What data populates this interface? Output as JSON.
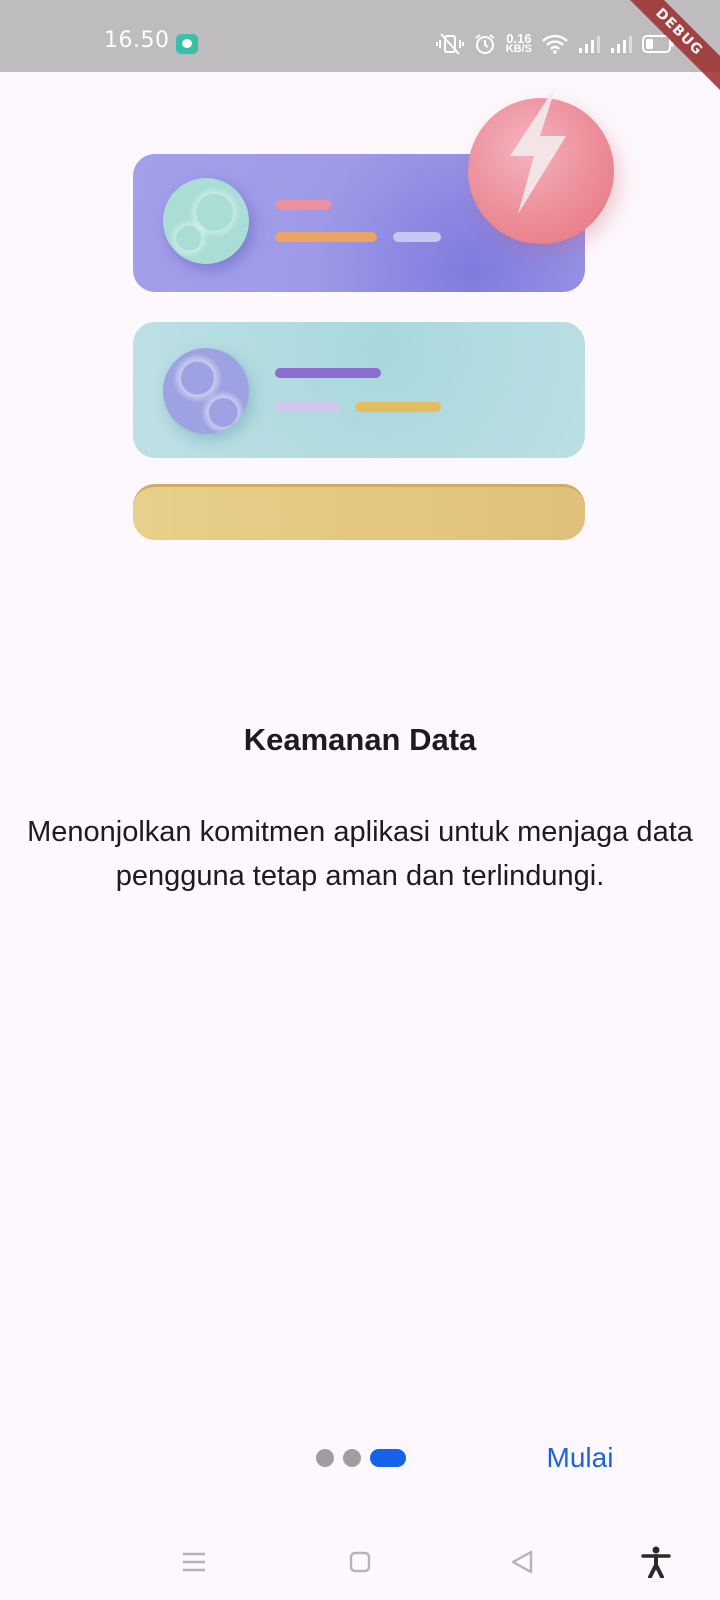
{
  "status_bar": {
    "time": "16.50",
    "net_speed_value": "0.16",
    "net_speed_unit": "KB/S"
  },
  "debug_banner": "DEBUG",
  "onboarding": {
    "title": "Keamanan Data",
    "description": "Menonjolkan komitmen aplikasi untuk menjaga data pengguna tetap aman dan terlindungi.",
    "page_count": 3,
    "current_page": 3,
    "start_label": "Mulai"
  },
  "colors": {
    "accent": "#1563e8",
    "start_text": "#1e63d8",
    "dot_inactive": "#9e9e9e",
    "background": "#fdf8fd",
    "debug_ribbon": "#9c2d2d"
  },
  "icons": {
    "status": [
      "chat-notification-icon",
      "vibrate-mute-icon",
      "alarm-icon",
      "wifi-icon",
      "signal-icon",
      "signal-icon",
      "battery-icon"
    ],
    "nav": [
      "menu-icon",
      "home-icon",
      "back-icon",
      "accessibility-icon"
    ]
  }
}
